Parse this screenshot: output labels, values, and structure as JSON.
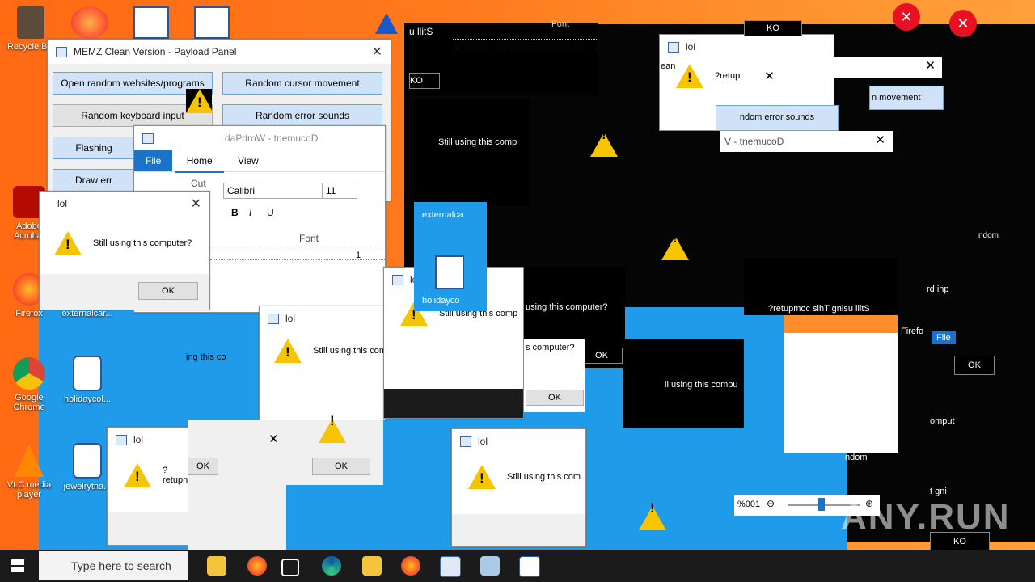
{
  "desktop": {
    "icons": [
      {
        "label": "Recycle Bin",
        "icon": "recycle-bin-icon"
      },
      {
        "label": "Adobe Acrobat",
        "icon": "acrobat-icon"
      },
      {
        "label": "Firefox",
        "icon": "firefox-icon"
      },
      {
        "label": "Google Chrome",
        "icon": "chrome-icon"
      },
      {
        "label": "VLC media player",
        "icon": "vlc-icon"
      },
      {
        "label": "externalcar...",
        "icon": "word-doc-icon"
      },
      {
        "label": "holidaycol...",
        "icon": "word-doc-icon"
      },
      {
        "label": "jewelrytha...",
        "icon": "word-doc-icon"
      }
    ]
  },
  "payload_panel": {
    "title": "MEMZ Clean Version - Payload Panel",
    "buttons": [
      "Open random websites/programs",
      "Random cursor movement",
      "Random keyboard input",
      "Random error sounds",
      "Flashing",
      "Draw err"
    ]
  },
  "wordpad": {
    "title": "daPdroW - tnemucoD",
    "tabs": [
      "File",
      "Home",
      "View"
    ],
    "font_name": "Calibri",
    "font_size": "11",
    "font_group": "Font",
    "cut_label": "Cut",
    "ruler_mark": "1",
    "zoom": "%001"
  },
  "dialogs": {
    "title": "lol",
    "message": "Still using this computer?",
    "message_mirror": "?retupmoc sihT gnisu llitS",
    "message_partial_1": "?retupn",
    "message_partial_2": "?retup",
    "ok": "OK",
    "ok_mirror": "KO"
  },
  "fragments": {
    "external": "externalca",
    "holiday": "holidayco",
    "still_using_the": "Still using this comp",
    "s_computer": "s computer?",
    "ll_using": "ll using this compu",
    "still_using_com": "Still using this com",
    "using_this_co": "ing this co",
    "using_computer": "using this computer?",
    "ean": "ean",
    "ndom_error": "ndom error sounds",
    "n_movement": "n movement",
    "mirror_title": "V - tnemucoD",
    "ndom": "ndom",
    "rd_inp": "rd inp",
    "t_gni": "t gni",
    "omput": "omput",
    "file": "File",
    "firefo": "Firefo",
    "acrc": "Acro",
    "googl": "Googl",
    "goo": "Goo",
    "sill": "u llitS"
  },
  "taskbar": {
    "search_placeholder": "Type here to search"
  },
  "watermark": "ANY.RUN",
  "colors": {
    "desktop": "#ff7a1c",
    "accent": "#0078d7",
    "warning": "#f7c400",
    "error": "#e81123"
  }
}
